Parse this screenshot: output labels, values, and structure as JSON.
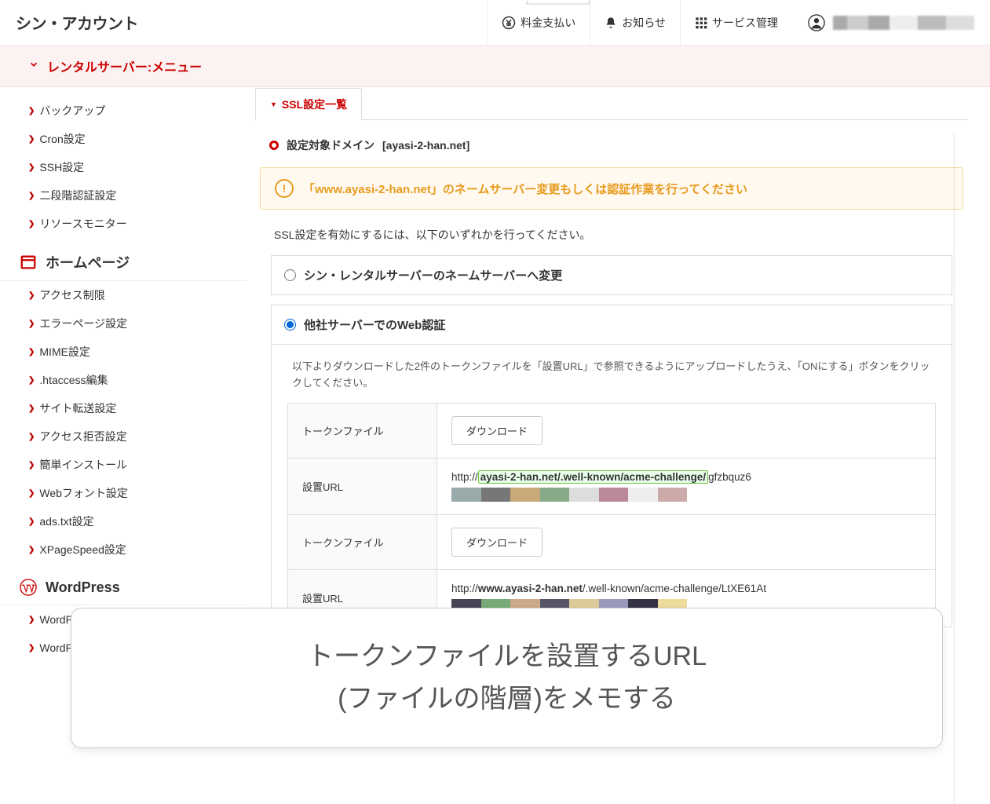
{
  "header": {
    "logo": "シン・アカウント",
    "pay": "料金支払い",
    "notice": "お知らせ",
    "service": "サービス管理"
  },
  "subbar": {
    "label": "レンタルサーバー:メニュー"
  },
  "sidebar": {
    "items1": [
      "バックアップ",
      "Cron設定",
      "SSH設定",
      "二段階認証設定",
      "リソースモニター"
    ],
    "cat_homepage": "ホームページ",
    "items2": [
      "アクセス制限",
      "エラーページ設定",
      "MIME設定",
      ".htaccess編集",
      "サイト転送設定",
      "アクセス拒否設定",
      "簡単インストール",
      "Webフォント設定",
      "ads.txt設定",
      "XPageSpeed設定"
    ],
    "cat_wp": "WordPress",
    "items3": [
      "WordPress簡単インストール",
      "WordPress簡単移行"
    ]
  },
  "main": {
    "tab": "SSL設定一覧",
    "domain_prefix": "設定対象ドメイン",
    "domain": "[ayasi-2-han.net]",
    "alert": "「www.ayasi-2-han.net」のネームサーバー変更もしくは認証作業を行ってください",
    "desc": "SSL設定を有効にするには、以下のいずれかを行ってください。",
    "opt1": "シン・レンタルサーバーのネームサーバーへ変更",
    "opt2": "他社サーバーでのWeb認証",
    "inner_desc": "以下よりダウンロードした2件のトークンファイルを「設置URL」で参照できるようにアップロードしたうえ、「ONにする」ボタンをクリックしてください。",
    "row_token": "トークンファイル",
    "row_url": "設置URL",
    "download": "ダウンロード",
    "url1_pre": "http://",
    "url1_host": "ayasi-2-han.net",
    "url1_path": "/.well-known/acme-challenge/",
    "url1_suffix": "gfzbquz6",
    "url2_pre": "http://",
    "url2_host": "www.ayasi-2-han.net",
    "url2_path": "/.well-known/acme-challenge/LtXE61At"
  },
  "callout": {
    "l1": "トークンファイルを設置するURL",
    "l2": "(ファイルの階層)をメモする"
  }
}
